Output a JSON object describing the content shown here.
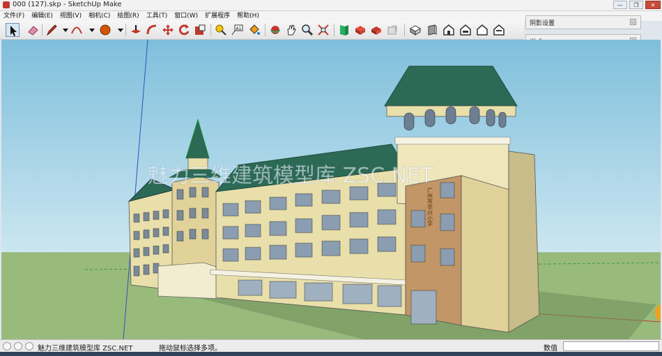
{
  "window": {
    "title": "000 (127).skp - SketchUp Make"
  },
  "menu": [
    "文件(F)",
    "编辑(E)",
    "视图(V)",
    "相机(C)",
    "绘图(R)",
    "工具(T)",
    "窗口(W)",
    "扩展程序",
    "帮助(H)"
  ],
  "toolbar": {
    "tools": [
      "select-icon",
      "eraser-icon",
      "pencil-icon",
      "dropdown-icon",
      "arc-icon",
      "dropdown-icon",
      "shape-icon",
      "dropdown-icon",
      "push-pull-icon",
      "follow-me-icon",
      "move-icon",
      "rotate-icon",
      "scale-icon",
      "tape-measure-icon",
      "text-icon",
      "paint-bucket-icon",
      "orbit-icon",
      "pan-icon",
      "zoom-icon",
      "zoom-extents-icon",
      "model-info-icon",
      "components-icon",
      "materials-icon",
      "warehouse-icon",
      "iso-view-icon",
      "top-view-icon",
      "front-view-icon",
      "right-view-icon",
      "back-view-icon",
      "left-view-icon"
    ]
  },
  "panels": [
    {
      "title": "阴影设置",
      "toggle": "⊟"
    },
    {
      "title": "样式",
      "toggle": "⊟"
    }
  ],
  "viewport": {
    "watermark": "魅力三维建筑模型库  ZSC.NET",
    "sign_text": "广州市华兴小学",
    "colors": {
      "sky": "#a8d4e8",
      "ground": "#98bb7c",
      "roof": "#2c6a55",
      "wall": "#e9dfaa",
      "brick": "#c29666"
    }
  },
  "status": {
    "overlay_text": "魅力三维建筑模型库  ZSC.NET",
    "hint": "拖动鼠标选择多项。",
    "measure_label": "数值",
    "measure_value": ""
  },
  "window_controls": {
    "minimize": "—",
    "maximize": "❐",
    "close": "✕"
  }
}
